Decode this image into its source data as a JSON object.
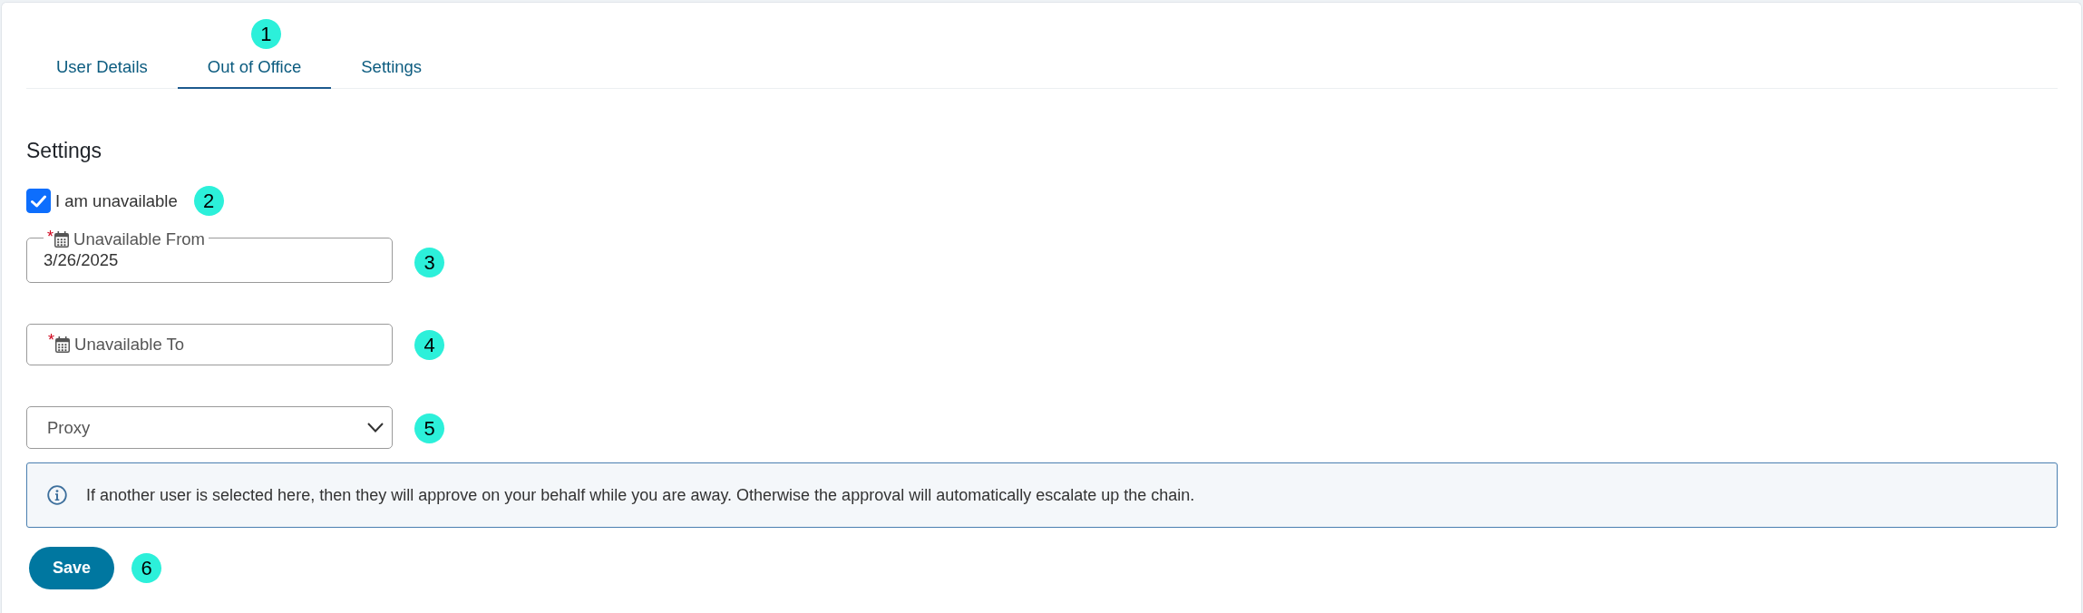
{
  "tabs": [
    {
      "label": "User Details",
      "selected": false
    },
    {
      "label": "Out of Office",
      "selected": true,
      "callout": "1"
    },
    {
      "label": "Settings",
      "selected": false
    }
  ],
  "section": {
    "title": "Settings"
  },
  "availability": {
    "label": "I am unavailable",
    "checked": true,
    "callout": "2"
  },
  "fields": [
    {
      "kind": "date",
      "required_mark": "*",
      "label": "Unavailable From",
      "value": "3/26/2025",
      "callout": "3"
    },
    {
      "kind": "date",
      "required_mark": "*",
      "label": "Unavailable To",
      "callout": "4"
    },
    {
      "kind": "select",
      "placeholder": "Proxy",
      "callout": "5"
    }
  ],
  "info_banner": {
    "text": "If another user is selected here, then they will approve on your behalf while you are away. Otherwise the approval will automatically escalate up the chain."
  },
  "save_button": {
    "label": "Save",
    "callout": "6"
  }
}
